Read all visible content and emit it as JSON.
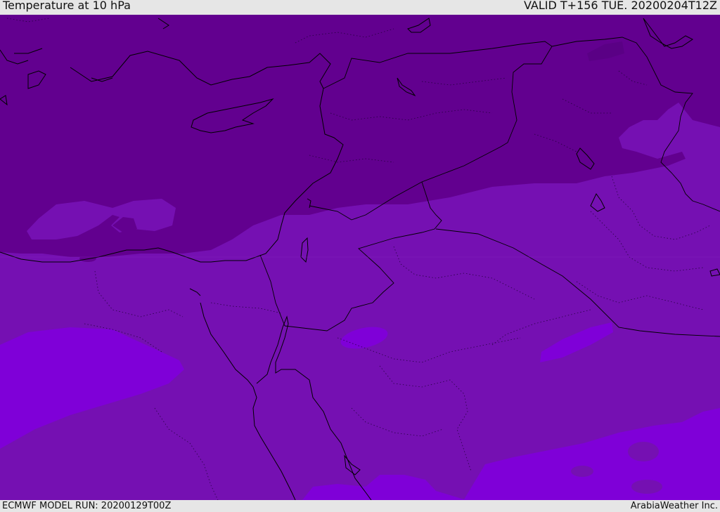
{
  "header": {
    "title": "Temperature at 10 hPa",
    "valid": "VALID T+156 TUE. 20200204T12Z"
  },
  "footer": {
    "model_run": "ECMWF MODEL RUN: 20200129T00Z",
    "credit": "ArabiaWeather Inc."
  },
  "map": {
    "colors": {
      "band_cold": "#62008f",
      "band_mid": "#7510b2",
      "band_warm": "#7f00d8",
      "coastline": "#000000"
    }
  }
}
